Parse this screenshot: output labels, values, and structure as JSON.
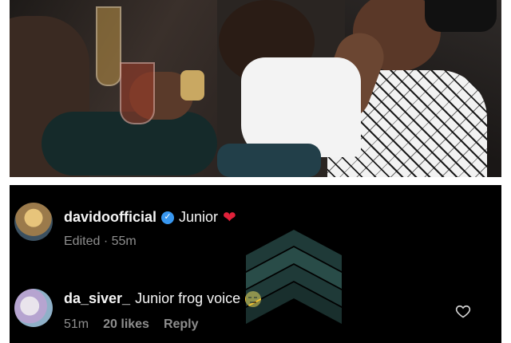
{
  "photo": {
    "description_icon": "photo-image"
  },
  "comments": [
    {
      "username": "davidoofficial",
      "verified": true,
      "text": "Junior",
      "emoji": "red-heart",
      "meta": {
        "edited": "Edited · 55m"
      }
    },
    {
      "username": "da_siver_",
      "verified": false,
      "text": "Junior frog voice",
      "emoji": "unamused-face",
      "meta": {
        "time": "51m",
        "likes": "20 likes",
        "reply": "Reply"
      },
      "like_icon": "heart-outline-icon"
    }
  ],
  "colors": {
    "background": "#000000",
    "text": "#f5f5f5",
    "meta": "#8e8e8e",
    "verified": "#3897f0",
    "heart": "#e0213a"
  }
}
